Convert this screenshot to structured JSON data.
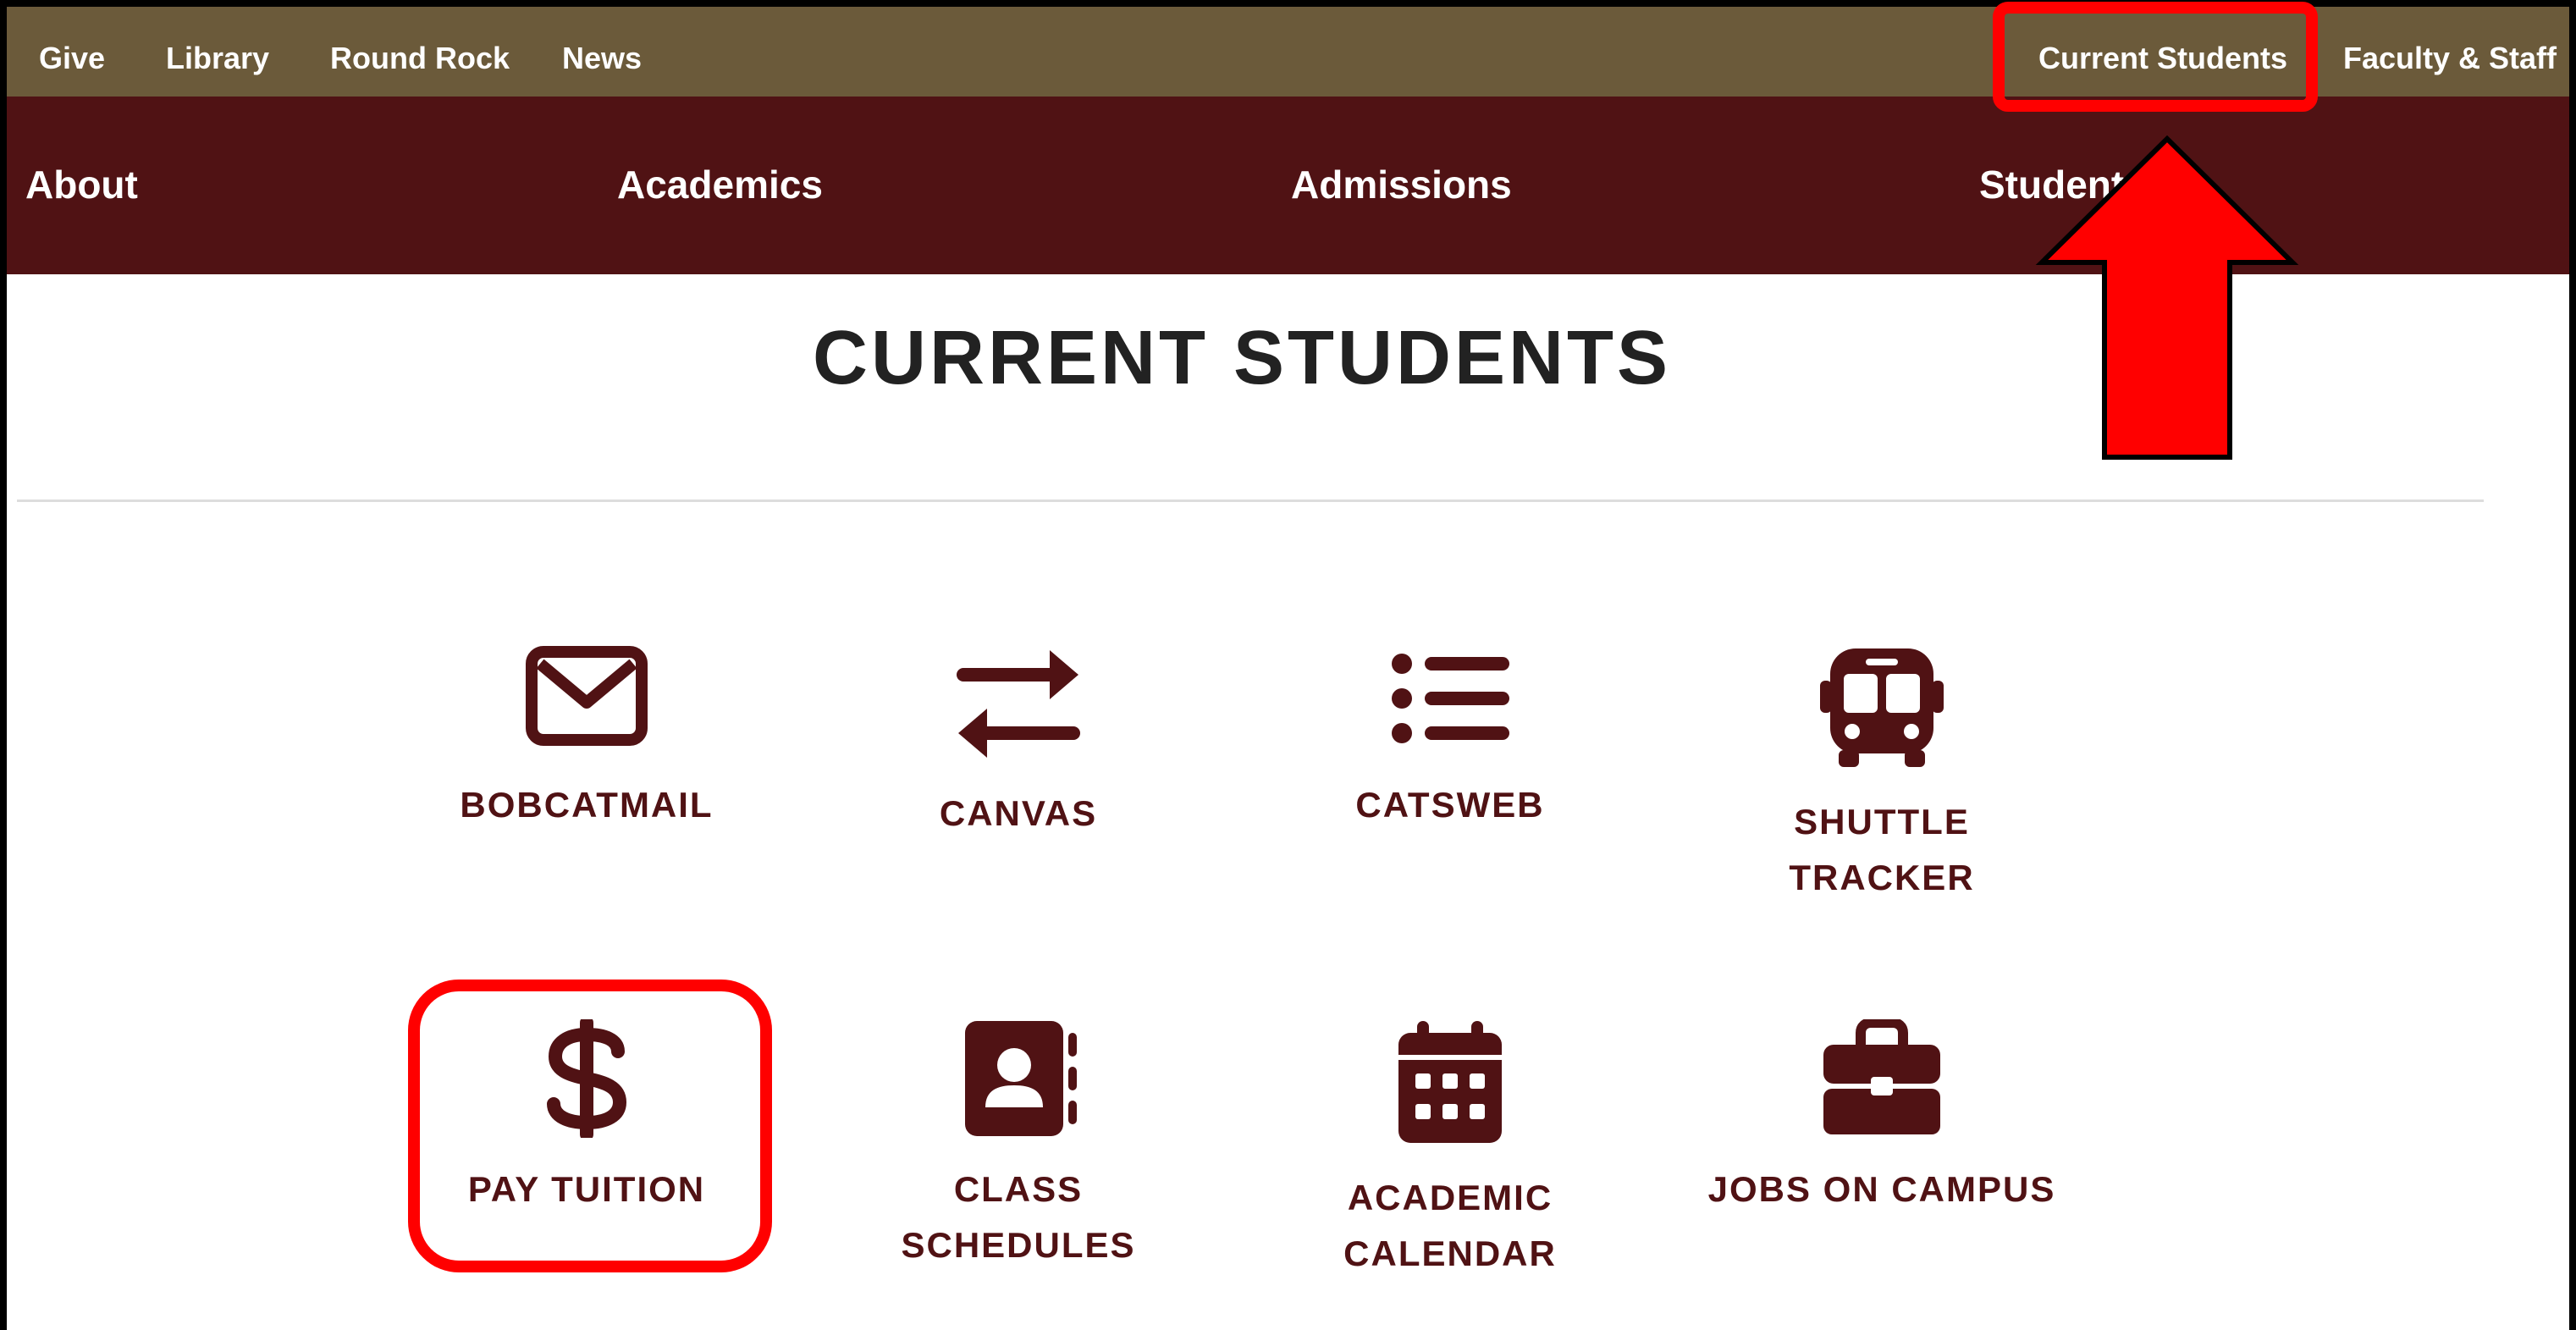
{
  "utility_nav": {
    "items": [
      "Give",
      "Library",
      "Round Rock",
      "News"
    ],
    "right_items": [
      "Current Students",
      "Faculty & Staff"
    ]
  },
  "main_nav": {
    "items": [
      "About",
      "Academics",
      "Admissions",
      "Student"
    ]
  },
  "page_title": "CURRENT STUDENTS",
  "tiles": [
    {
      "label": "BOBCATMAIL",
      "icon": "envelope-icon"
    },
    {
      "label": "CANVAS",
      "icon": "arrows-exchange-icon"
    },
    {
      "label": "CATSWEB",
      "icon": "list-icon"
    },
    {
      "label": "SHUTTLE TRACKER",
      "icon": "bus-icon"
    },
    {
      "label": "PAY TUITION",
      "icon": "dollar-icon"
    },
    {
      "label": "CLASS SCHEDULES",
      "icon": "address-book-icon"
    },
    {
      "label": "ACADEMIC CALENDAR",
      "icon": "calendar-icon"
    },
    {
      "label": "JOBS ON CAMPUS",
      "icon": "briefcase-icon"
    }
  ],
  "colors": {
    "utility_bar": "#6b5a3a",
    "main_nav": "#501214",
    "accent_maroon": "#501214",
    "annotation_red": "#ff0000"
  }
}
